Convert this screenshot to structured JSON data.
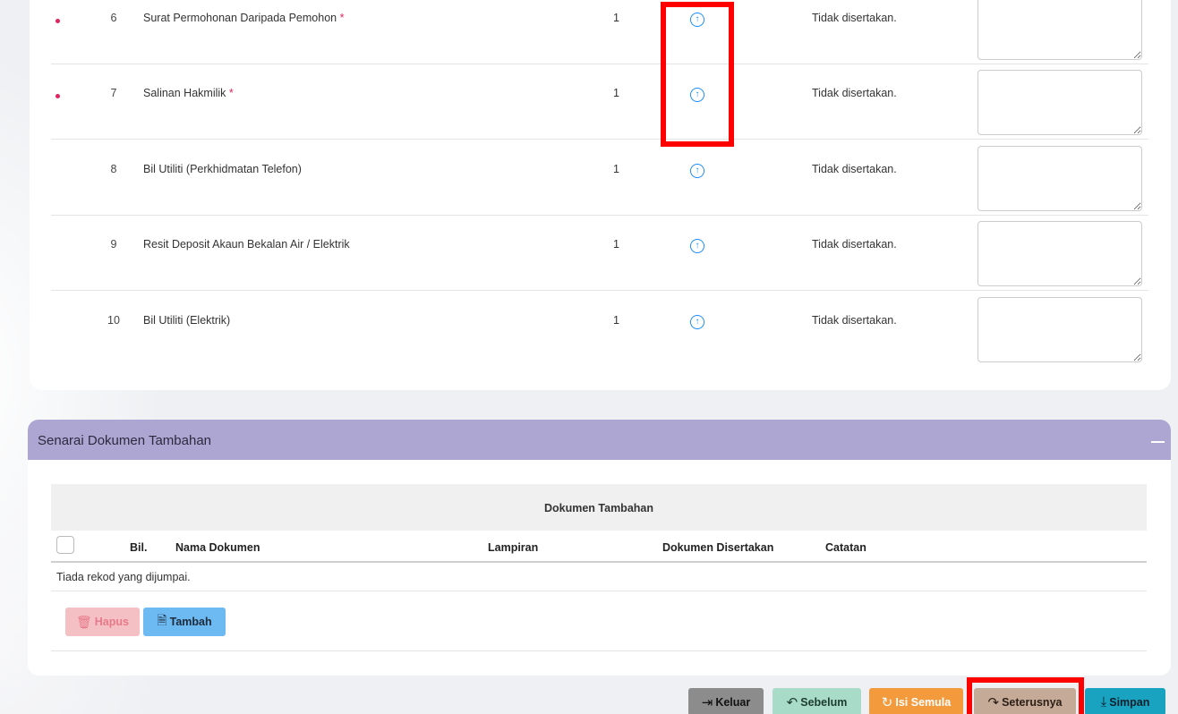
{
  "documents": [
    {
      "bil": "6",
      "nama": "Surat Permohonan Daripada Pemohon ",
      "required_mark": "*",
      "required": true,
      "qty": "1",
      "status": "Tidak disertakan."
    },
    {
      "bil": "7",
      "nama": "Salinan Hakmilik ",
      "required_mark": "*",
      "required": true,
      "qty": "1",
      "status": "Tidak disertakan."
    },
    {
      "bil": "8",
      "nama": "Bil Utiliti (Perkhidmatan Telefon)",
      "required_mark": "",
      "required": false,
      "qty": "1",
      "status": "Tidak disertakan."
    },
    {
      "bil": "9",
      "nama": "Resit Deposit Akaun Bekalan Air / Elektrik",
      "required_mark": "",
      "required": false,
      "qty": "1",
      "status": "Tidak disertakan."
    },
    {
      "bil": "10",
      "nama": "Bil Utiliti (Elektrik)",
      "required_mark": "",
      "required": false,
      "qty": "1",
      "status": "Tidak disertakan."
    }
  ],
  "additional": {
    "panel_title": "Senarai Dokumen Tambahan",
    "table_title": "Dokumen Tambahan",
    "columns": {
      "bil": "Bil.",
      "nama": "Nama Dokumen",
      "lampiran": "Lampiran",
      "disertakan": "Dokumen Disertakan",
      "catatan": "Catatan"
    },
    "empty_text": "Tiada rekod yang dijumpai.",
    "hapus_label": "Hapus",
    "tambah_label": "Tambah"
  },
  "footer": {
    "keluar": "Keluar",
    "sebelum": "Sebelum",
    "isi_semula": "Isi Semula",
    "seterusnya": "Seterusnya",
    "simpan": "Simpan"
  },
  "colors": {
    "required": "#e0245e",
    "upload": "#1a8cff",
    "panel_header": "#ada6d2",
    "highlight": "#ff0000",
    "btn_keluar": "#8c8c8c",
    "btn_sebelum": "#a8dcc8",
    "btn_isi_semula": "#f39a3d",
    "btn_seterusnya": "#c6aa98",
    "btn_simpan": "#19a3c0",
    "btn_hapus": "#f4c0c4",
    "btn_tambah": "#6db9f2"
  },
  "icons": {
    "upload": "arrow-up-circle-icon",
    "hapus": "trash-icon",
    "tambah": "file-add-icon",
    "keluar": "exit-icon",
    "sebelum": "reply-icon",
    "isi_semula": "refresh-icon",
    "seterusnya": "forward-icon",
    "simpan": "download-icon"
  }
}
